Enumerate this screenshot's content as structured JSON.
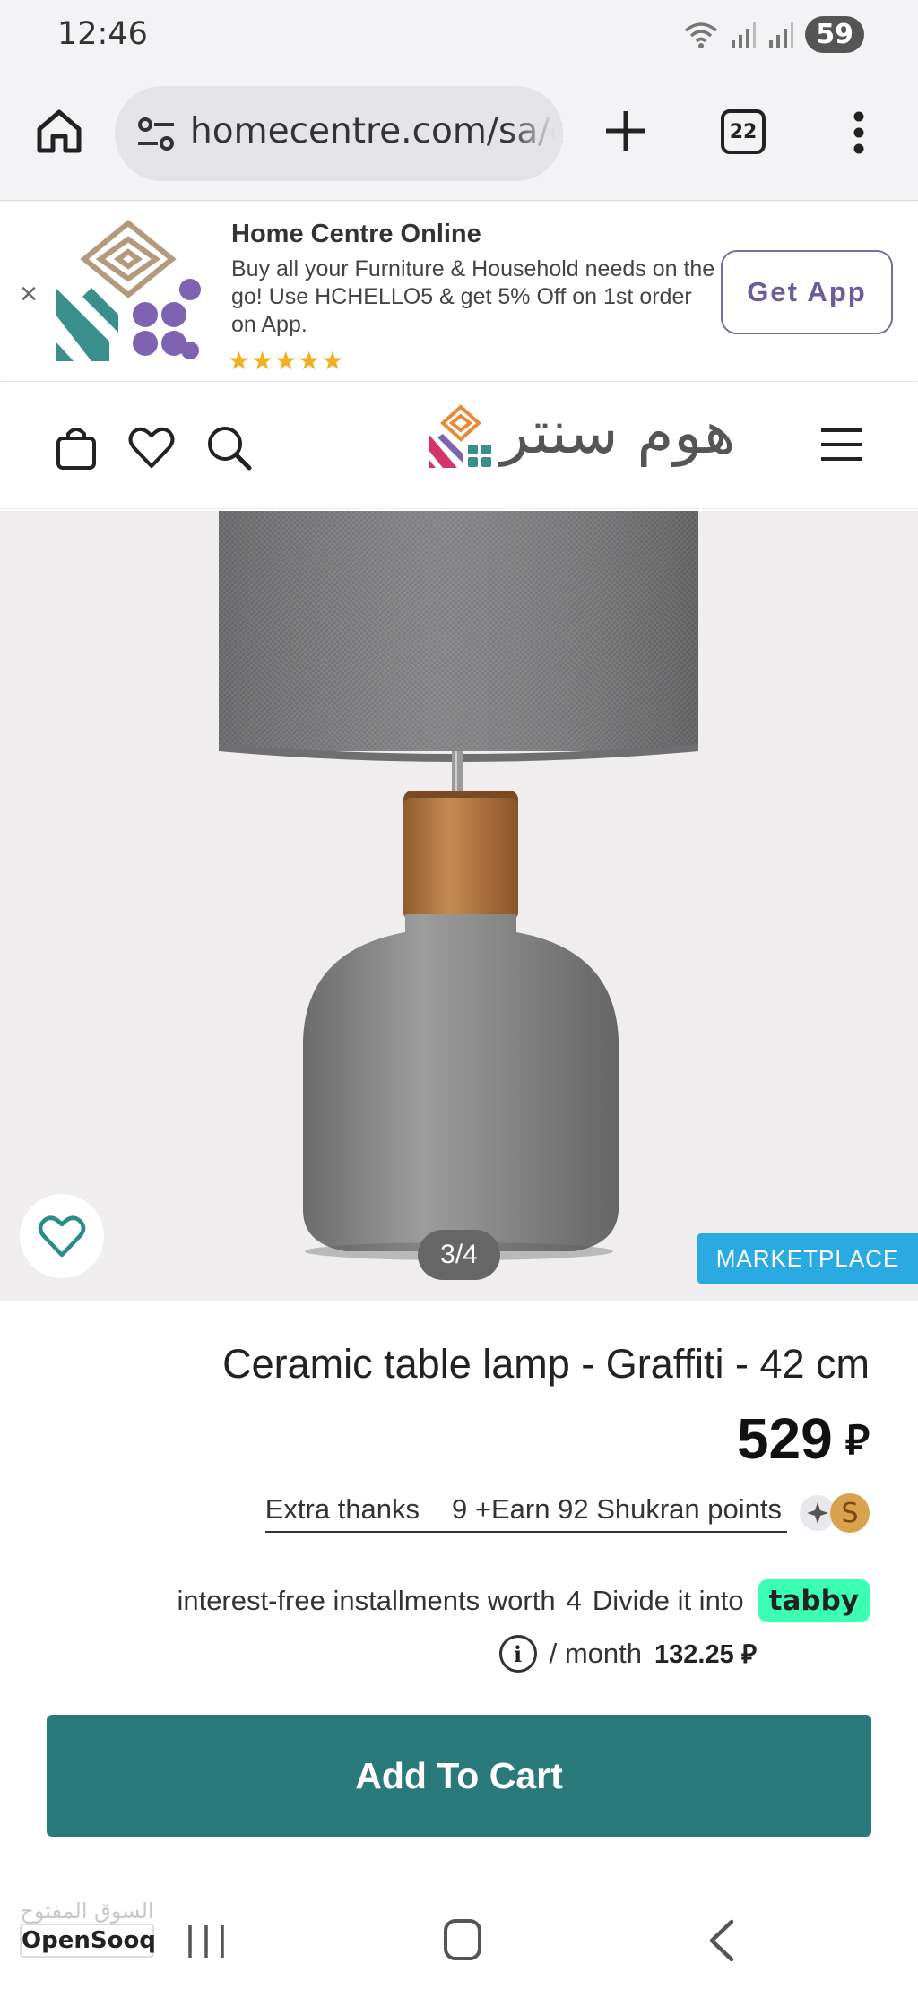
{
  "status_bar": {
    "time": "12:46",
    "battery": "59",
    "icons": [
      "wifi-icon",
      "signal-icon",
      "signal-icon",
      "battery-icon"
    ]
  },
  "browser": {
    "url": "homecentre.com/sa/en/",
    "tab_count": "22",
    "icons": [
      "home-icon",
      "site-settings-icon",
      "new-tab-icon",
      "tabs-icon",
      "more-menu-icon"
    ]
  },
  "app_banner": {
    "close": "×",
    "title": "Home Centre Online",
    "description": "Buy all your Furniture & Household needs on the go! Use HCHELLO5 & get 5% Off on 1st order on App.",
    "stars": "★★★★★",
    "cta": "Get App"
  },
  "header": {
    "brand": "هوم سنتر",
    "icons": [
      "bag-icon",
      "heart-icon",
      "search-icon",
      "hamburger-menu-icon"
    ]
  },
  "gallery": {
    "counter": "3/4",
    "tag": "MARKETPLACE"
  },
  "product": {
    "title": "Ceramic table lamp - Graffiti - 42 cm",
    "price": "529",
    "currency_symbol": "⃁",
    "shukran": {
      "extra": "Extra thanks",
      "earn": "9 +Earn 92 Shukran points",
      "coin": "S"
    },
    "installments": {
      "text_a": "interest-free installments worth",
      "number": "4",
      "text_b": "Divide it into",
      "provider": "tabby",
      "per_month": "/ month",
      "monthly_amount": "132.25",
      "info": "i"
    }
  },
  "cart": {
    "button": "Add To Cart"
  },
  "watermark": {
    "arabic": "السوق المفتوح",
    "english": "OpenSooq"
  },
  "colors": {
    "accent_teal": "#2b7a7b",
    "marketplace_blue": "#29abe2",
    "tabby_green": "#3bffb2",
    "banner_purple": "#6c5c9a",
    "star_gold": "#f2b01e"
  }
}
